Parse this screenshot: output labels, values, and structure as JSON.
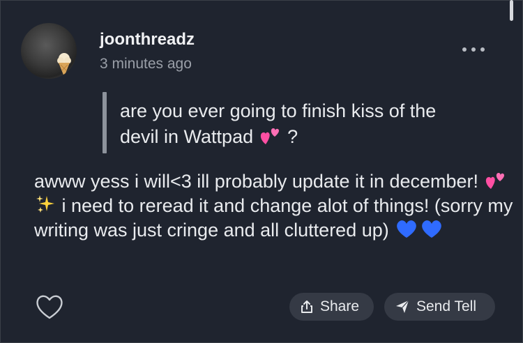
{
  "post": {
    "username": "joonthreadz",
    "time": "3 minutes ago"
  },
  "question": {
    "line1": "are you ever going to finish kiss of the",
    "line2_text": "devil in Wattpad",
    "line2_end": "?"
  },
  "answer": {
    "part1": "awww yess i will<3 ill probably update it in december!",
    "part2": "i need to reread it and change alot of things! (sorry my writing was just cringe and all cluttered up)"
  },
  "actions": {
    "share_label": "Share",
    "send_tell_label": "Send Tell"
  },
  "colors": {
    "background": "#1f242f",
    "pill": "#353a45",
    "blue_heart": "#2f6bff",
    "pink_heart": "#ff4fa3"
  },
  "icons": [
    "avatar",
    "more-options-icon",
    "two-hearts-emoji",
    "sparkles-emoji",
    "blue-heart-emoji",
    "like-heart-icon",
    "share-icon",
    "send-icon"
  ]
}
